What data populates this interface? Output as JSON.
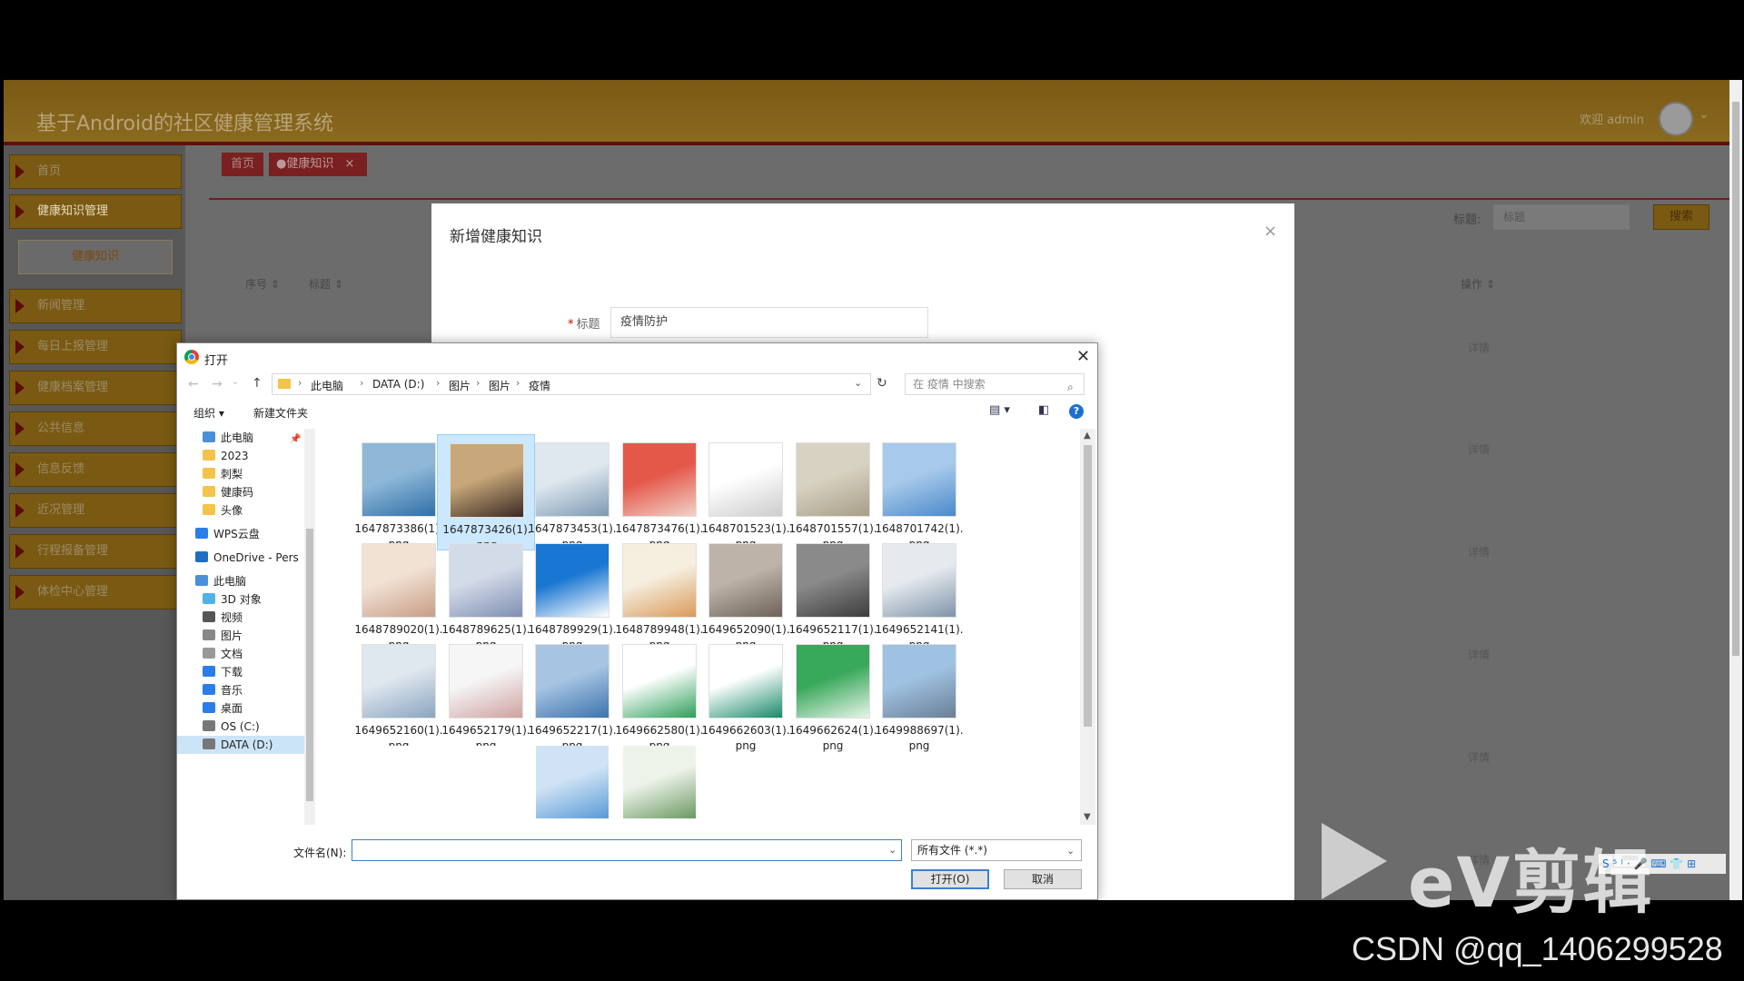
{
  "app": {
    "title": "基于Android的社区健康管理系统",
    "welcome": "欢迎 admin",
    "avatar_caret": "⌄",
    "sidebar": [
      {
        "label": "首页"
      },
      {
        "label": "健康知识管理"
      },
      {
        "label": "健康知识",
        "sub": true
      },
      {
        "label": "新闻管理"
      },
      {
        "label": "每日上报管理"
      },
      {
        "label": "健康档案管理"
      },
      {
        "label": "公共信息"
      },
      {
        "label": "信息反馈"
      },
      {
        "label": "近况管理"
      },
      {
        "label": "行程报备管理"
      },
      {
        "label": "体检中心管理"
      }
    ],
    "tabs": {
      "home": "首页",
      "current": "●健康知识",
      "close": "×"
    },
    "search": {
      "label": "标题:",
      "placeholder": "标题",
      "button": "搜索"
    },
    "table": {
      "headers": [
        "序号 ⇕",
        "标题 ⇕",
        "操作 ⇕"
      ],
      "detail": "详情"
    }
  },
  "modal": {
    "title": "新增健康知识",
    "close": "×",
    "field_required": "*",
    "field_label": "标题",
    "field_value": "疫情防护"
  },
  "dialog": {
    "title": "打开",
    "close": "✕",
    "nav": {
      "back": "←",
      "forward": "→",
      "recent": "⌄",
      "up": "↑",
      "refresh": "↻"
    },
    "breadcrumb": [
      "此电脑",
      "DATA (D:)",
      "图片",
      "图片",
      "疫情"
    ],
    "crumb_sep": "›",
    "address_dropdown": "⌄",
    "search_placeholder": "在 疫情 中搜索",
    "search_icon": "⌕",
    "organize": "组织 ▾",
    "new_folder": "新建文件夹",
    "view_icon": "▤ ▾",
    "pane_icon": "◧",
    "help_icon": "?",
    "nav_pane": [
      {
        "label": "此电脑",
        "icon": "pc-icon",
        "color": "#4a90d9"
      },
      {
        "label": "2023",
        "icon": "folder-icon",
        "color": "#f3c34a"
      },
      {
        "label": "刺梨",
        "icon": "folder-icon",
        "color": "#f3c34a"
      },
      {
        "label": "健康码",
        "icon": "folder-icon",
        "color": "#f3c34a"
      },
      {
        "label": "头像",
        "icon": "folder-icon",
        "color": "#f3c34a"
      },
      {
        "label": "WPS云盘",
        "icon": "cloud-icon",
        "color": "#2b7de9"
      },
      {
        "label": "OneDrive - Pers",
        "icon": "cloud-icon",
        "color": "#1f6cc1"
      },
      {
        "label": "此电脑",
        "icon": "pc-icon",
        "color": "#4a90d9"
      },
      {
        "label": "3D 对象",
        "icon": "cube-icon",
        "color": "#4fb3e8"
      },
      {
        "label": "视频",
        "icon": "video-icon",
        "color": "#555"
      },
      {
        "label": "图片",
        "icon": "picture-icon",
        "color": "#888"
      },
      {
        "label": "文档",
        "icon": "document-icon",
        "color": "#999"
      },
      {
        "label": "下载",
        "icon": "download-icon",
        "color": "#2b7de9"
      },
      {
        "label": "音乐",
        "icon": "music-icon",
        "color": "#2b7de9"
      },
      {
        "label": "桌面",
        "icon": "desktop-icon",
        "color": "#2b7de9"
      },
      {
        "label": "OS (C:)",
        "icon": "drive-icon",
        "color": "#777"
      },
      {
        "label": "DATA (D:)",
        "icon": "drive-icon",
        "color": "#777",
        "selected": true
      }
    ],
    "pin_icon": "📌",
    "files": [
      {
        "name": "1647873386(1).",
        "ext": "png",
        "colors": [
          "#8fb8d8",
          "#2e6fa8"
        ]
      },
      {
        "name": "1647873426(1).",
        "ext": "png",
        "colors": [
          "#c8a87a",
          "#3a2a22"
        ],
        "selected": true
      },
      {
        "name": "1647873453(1).",
        "ext": "png",
        "colors": [
          "#dfe8ee",
          "#7c99b3"
        ]
      },
      {
        "name": "1647873476(1).",
        "ext": "png",
        "colors": [
          "#e4584a",
          "#f2d2c8"
        ]
      },
      {
        "name": "1648701523(1).",
        "ext": "png",
        "colors": [
          "#ffffff",
          "#cccccc"
        ]
      },
      {
        "name": "1648701557(1).",
        "ext": "png",
        "colors": [
          "#d8d2c2",
          "#a89e88"
        ]
      },
      {
        "name": "1648701742(1).",
        "ext": "png",
        "colors": [
          "#a7c9ea",
          "#4a8acb"
        ]
      },
      {
        "name": "1648789020(1).",
        "ext": "png",
        "colors": [
          "#f1e2d4",
          "#c79d86"
        ]
      },
      {
        "name": "1648789625(1).",
        "ext": "png",
        "colors": [
          "#d4dbe8",
          "#7f8fb3"
        ]
      },
      {
        "name": "1648789929(1).",
        "ext": "png",
        "colors": [
          "#1976d2",
          "#ffffff"
        ]
      },
      {
        "name": "1648789948(1).",
        "ext": "png",
        "colors": [
          "#f6efe0",
          "#d99a5a"
        ]
      },
      {
        "name": "1649652090(1).",
        "ext": "png",
        "colors": [
          "#bdb3a8",
          "#6e6258"
        ]
      },
      {
        "name": "1649652117(1).",
        "ext": "png",
        "colors": [
          "#8a8a8a",
          "#3d3d3d"
        ]
      },
      {
        "name": "1649652141(1).",
        "ext": "png",
        "colors": [
          "#e6eaef",
          "#7f94a8"
        ]
      },
      {
        "name": "1649652160(1).",
        "ext": "png",
        "colors": [
          "#dfe7ef",
          "#8aa5bf"
        ]
      },
      {
        "name": "1649652179(1).",
        "ext": "png",
        "colors": [
          "#f6f6f6",
          "#cfa1a1"
        ]
      },
      {
        "name": "1649652217(1).",
        "ext": "png",
        "colors": [
          "#a7c5e3",
          "#3d73ad"
        ]
      },
      {
        "name": "1649662580(1).",
        "ext": "png",
        "colors": [
          "#ffffff",
          "#2e9f5a"
        ]
      },
      {
        "name": "1649662603(1).",
        "ext": "png",
        "colors": [
          "#ffffff",
          "#1a8a6a"
        ]
      },
      {
        "name": "1649662624(1).",
        "ext": "png",
        "colors": [
          "#38a85a",
          "#e8f4ea"
        ]
      },
      {
        "name": "1649988697(1).",
        "ext": "png",
        "colors": [
          "#9fc2e2",
          "#6b7f96"
        ]
      },
      {
        "name": "",
        "ext": "",
        "colors": [
          "#ffffff",
          "#ffffff"
        ]
      },
      {
        "name": "",
        "ext": "",
        "colors": [
          "#ffffff",
          "#ffffff"
        ]
      },
      {
        "name": "",
        "ext": "",
        "colors": [
          "#cfe3f4",
          "#5a9ad6"
        ]
      },
      {
        "name": "",
        "ext": "",
        "colors": [
          "#eef3ea",
          "#6a9a62"
        ]
      }
    ],
    "filename_label": "文件名(N):",
    "filename_value": "",
    "filename_dropdown": "⌄",
    "filetype": "所有文件 (*.*)",
    "filetype_dropdown": "⌄",
    "open": "打开(O)",
    "cancel": "取消",
    "scroll_up": "▲",
    "scroll_down": "▼"
  },
  "watermark": {
    "ev": "eV剪辑",
    "ime": "S ⁵ ⁾ · 🎤 ⌨ 👕 ⊞",
    "csdn": "CSDN @qq_1406299528"
  }
}
